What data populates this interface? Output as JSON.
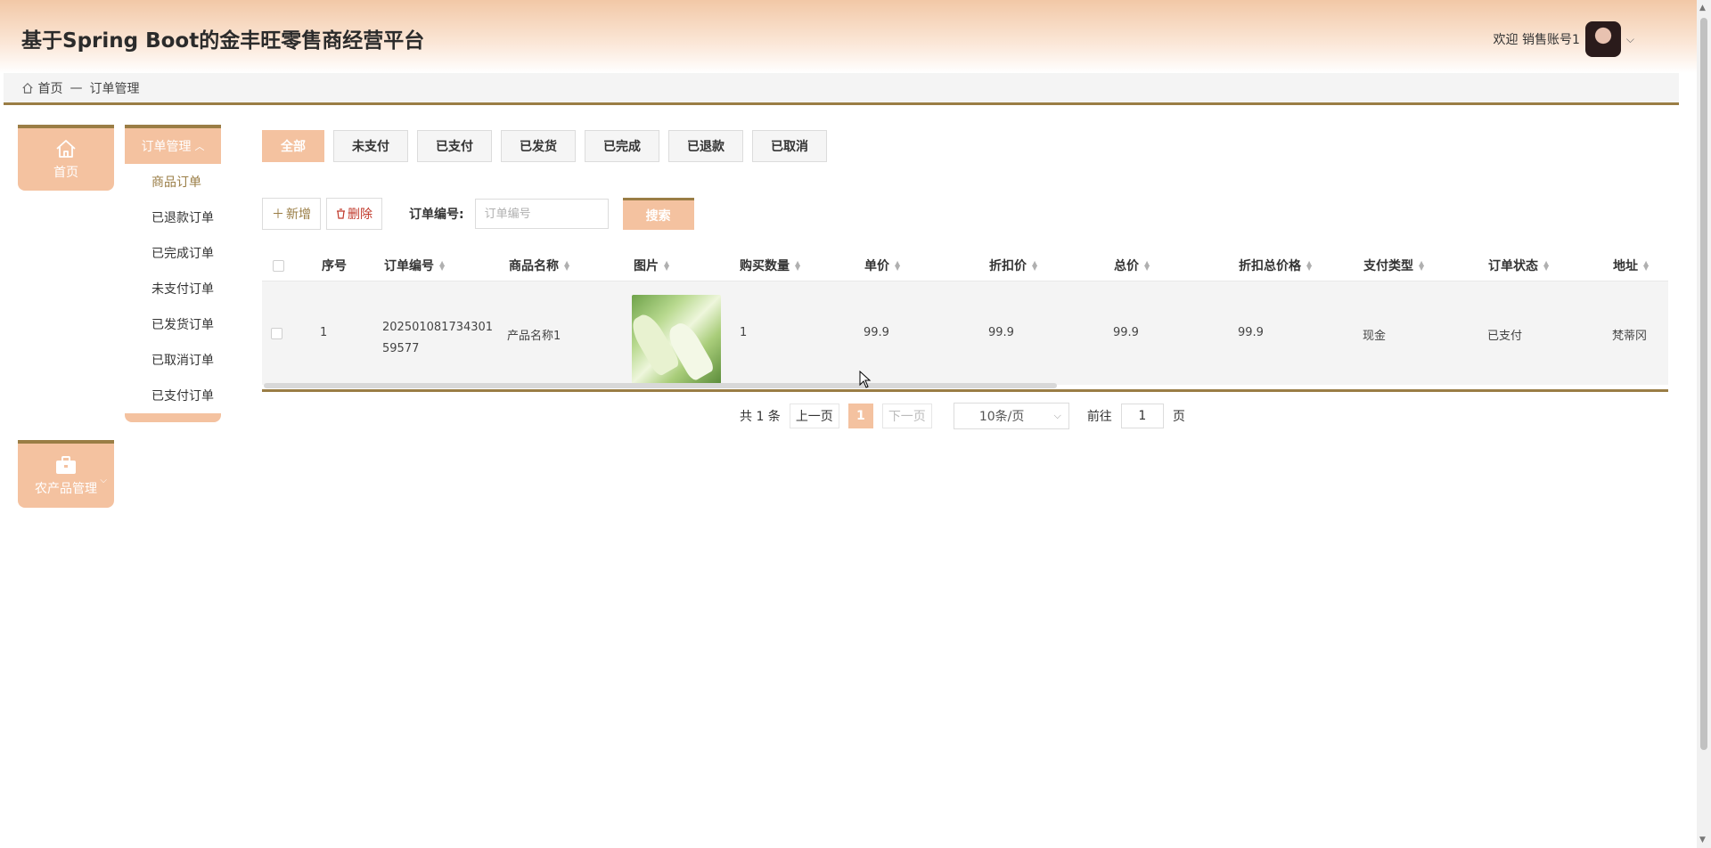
{
  "header": {
    "title": "基于Spring Boot的金丰旺零售商经营平台",
    "welcome": "欢迎 销售账号1"
  },
  "breadcrumb": {
    "home": "首页",
    "separator": "—",
    "current": "订单管理"
  },
  "nav": {
    "home_label": "首页",
    "farm_label": "农产品管理"
  },
  "submenu": {
    "title": "订单管理",
    "items": [
      {
        "label": "商品订单",
        "active": true
      },
      {
        "label": "已退款订单"
      },
      {
        "label": "已完成订单"
      },
      {
        "label": "未支付订单"
      },
      {
        "label": "已发货订单"
      },
      {
        "label": "已取消订单"
      },
      {
        "label": "已支付订单"
      }
    ]
  },
  "tabs": [
    "全部",
    "未支付",
    "已支付",
    "已发货",
    "已完成",
    "已退款",
    "已取消"
  ],
  "toolbar": {
    "add_label": "新增",
    "delete_label": "删除",
    "order_no_label": "订单编号:",
    "order_no_placeholder": "订单编号",
    "search_label": "搜索"
  },
  "table": {
    "columns": [
      "序号",
      "订单编号",
      "商品名称",
      "图片",
      "购买数量",
      "单价",
      "折扣价",
      "总价",
      "折扣总价格",
      "支付类型",
      "订单状态",
      "地址"
    ],
    "rows": [
      {
        "index": "1",
        "order_no_line1": "202501081734301",
        "order_no_line2": "59577",
        "product_name": "产品名称1",
        "quantity": "1",
        "unit_price": "99.9",
        "discount_price": "99.9",
        "total": "99.9",
        "discount_total": "99.9",
        "pay_type": "现金",
        "status": "已支付",
        "address": "梵蒂冈"
      }
    ]
  },
  "pagination": {
    "total": "共 1 条",
    "prev": "上一页",
    "current": "1",
    "next": "下一页",
    "page_size": "10条/页",
    "goto_label": "前往",
    "goto_value": "1",
    "page_unit": "页"
  },
  "colors": {
    "accent": "#f4c2a0",
    "border_accent": "#9a7d45"
  }
}
